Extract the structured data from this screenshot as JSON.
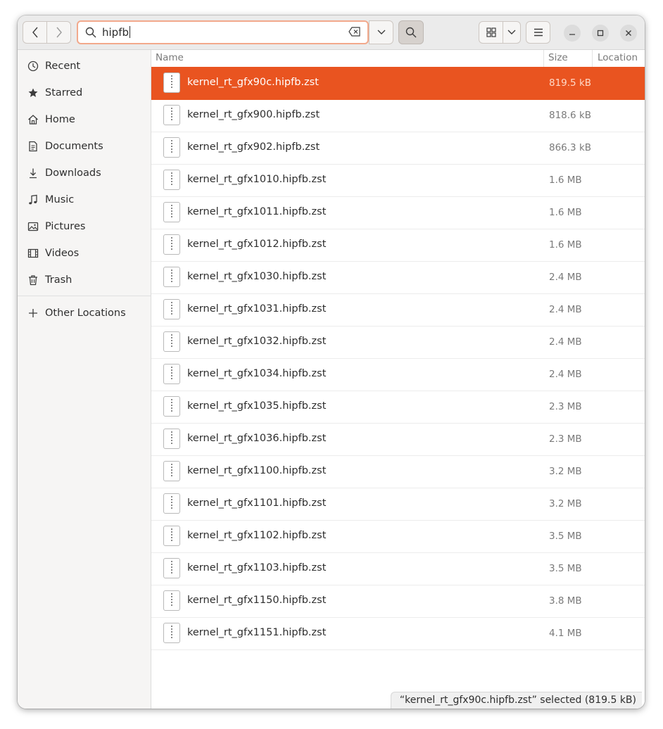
{
  "search": {
    "query": "hipfb"
  },
  "sidebar": {
    "items": [
      {
        "label": "Recent",
        "icon": "clock-icon"
      },
      {
        "label": "Starred",
        "icon": "star-icon"
      },
      {
        "label": "Home",
        "icon": "home-icon"
      },
      {
        "label": "Documents",
        "icon": "document-icon"
      },
      {
        "label": "Downloads",
        "icon": "download-icon"
      },
      {
        "label": "Music",
        "icon": "music-icon"
      },
      {
        "label": "Pictures",
        "icon": "picture-icon"
      },
      {
        "label": "Videos",
        "icon": "video-icon"
      },
      {
        "label": "Trash",
        "icon": "trash-icon"
      }
    ],
    "other": {
      "label": "Other Locations",
      "icon": "plus-icon"
    }
  },
  "columns": {
    "name": "Name",
    "size": "Size",
    "location": "Location"
  },
  "files": [
    {
      "name": "kernel_rt_gfx90c.hipfb.zst",
      "size": "819.5 kB",
      "selected": true
    },
    {
      "name": "kernel_rt_gfx900.hipfb.zst",
      "size": "818.6 kB"
    },
    {
      "name": "kernel_rt_gfx902.hipfb.zst",
      "size": "866.3 kB"
    },
    {
      "name": "kernel_rt_gfx1010.hipfb.zst",
      "size": "1.6 MB"
    },
    {
      "name": "kernel_rt_gfx1011.hipfb.zst",
      "size": "1.6 MB"
    },
    {
      "name": "kernel_rt_gfx1012.hipfb.zst",
      "size": "1.6 MB"
    },
    {
      "name": "kernel_rt_gfx1030.hipfb.zst",
      "size": "2.4 MB"
    },
    {
      "name": "kernel_rt_gfx1031.hipfb.zst",
      "size": "2.4 MB"
    },
    {
      "name": "kernel_rt_gfx1032.hipfb.zst",
      "size": "2.4 MB"
    },
    {
      "name": "kernel_rt_gfx1034.hipfb.zst",
      "size": "2.4 MB"
    },
    {
      "name": "kernel_rt_gfx1035.hipfb.zst",
      "size": "2.3 MB"
    },
    {
      "name": "kernel_rt_gfx1036.hipfb.zst",
      "size": "2.3 MB"
    },
    {
      "name": "kernel_rt_gfx1100.hipfb.zst",
      "size": "3.2 MB"
    },
    {
      "name": "kernel_rt_gfx1101.hipfb.zst",
      "size": "3.2 MB"
    },
    {
      "name": "kernel_rt_gfx1102.hipfb.zst",
      "size": "3.5 MB"
    },
    {
      "name": "kernel_rt_gfx1103.hipfb.zst",
      "size": "3.5 MB"
    },
    {
      "name": "kernel_rt_gfx1150.hipfb.zst",
      "size": "3.8 MB"
    },
    {
      "name": "kernel_rt_gfx1151.hipfb.zst",
      "size": "4.1 MB"
    }
  ],
  "status": "“kernel_rt_gfx90c.hipfb.zst” selected  (819.5 kB)",
  "colors": {
    "accent": "#e95420",
    "sidebar_bg": "#f6f5f4",
    "header_bg": "#ebebeb"
  }
}
